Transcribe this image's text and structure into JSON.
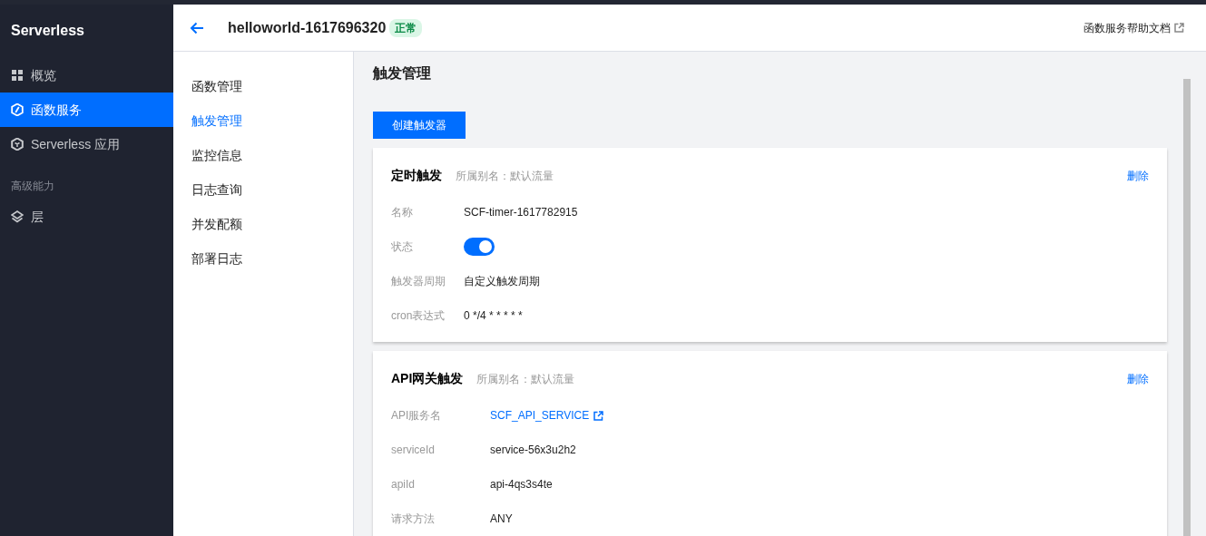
{
  "sidebar": {
    "brand": "Serverless",
    "items": [
      {
        "kind": "item",
        "label": "概览",
        "selected": false
      },
      {
        "kind": "item",
        "label": "函数服务",
        "selected": true
      },
      {
        "kind": "item",
        "label": "Serverless 应用",
        "selected": false
      },
      {
        "kind": "group",
        "label": "高级能力"
      },
      {
        "kind": "item",
        "label": "层",
        "selected": false
      }
    ]
  },
  "header": {
    "title": "helloworld-1617696320",
    "status": "正常",
    "help_link": "函数服务帮助文档"
  },
  "subnav": [
    {
      "label": "函数管理",
      "selected": false
    },
    {
      "label": "触发管理",
      "selected": true
    },
    {
      "label": "监控信息",
      "selected": false
    },
    {
      "label": "日志查询",
      "selected": false
    },
    {
      "label": "并发配额",
      "selected": false
    },
    {
      "label": "部署日志",
      "selected": false
    }
  ],
  "page_title": "触发管理",
  "create_button": "创建触发器",
  "triggers": [
    {
      "title": "定时触发",
      "alias": "所属别名：默认流量",
      "delete": "删除",
      "fields": [
        {
          "kind": "text",
          "label": "名称",
          "value": "SCF-timer-1617782915"
        },
        {
          "kind": "toggle",
          "label": "状态",
          "on": true
        },
        {
          "kind": "text",
          "label": "触发器周期",
          "value": "自定义触发周期"
        },
        {
          "kind": "text",
          "label": "cron表达式",
          "value": "0 */4 * * * * *"
        }
      ]
    },
    {
      "title": "API网关触发",
      "alias": "所属别名：默认流量",
      "delete": "删除",
      "fields": [
        {
          "kind": "link",
          "label": "API服务名",
          "value": "SCF_API_SERVICE"
        },
        {
          "kind": "text",
          "label": "serviceId",
          "value": "service-56x3u2h2"
        },
        {
          "kind": "text",
          "label": "apiId",
          "value": "api-4qs3s4te"
        },
        {
          "kind": "text",
          "label": "请求方法",
          "value": "ANY"
        }
      ]
    }
  ]
}
